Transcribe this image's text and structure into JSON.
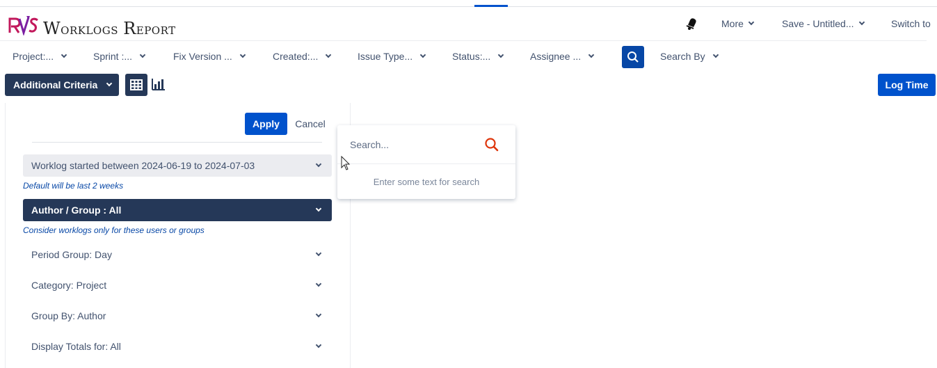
{
  "header": {
    "app_title_initial_1": "W",
    "app_title_rest_1": "orklogs",
    "app_title_initial_2": "R",
    "app_title_rest_2": "eport",
    "logo_icon": "rvs-logo",
    "notification_icon": "bell-icon",
    "more_label": "More",
    "save_label": "Save - Untitled...",
    "switch_label": "Switch to"
  },
  "filters": [
    {
      "label": "Project:..."
    },
    {
      "label": "Sprint :..."
    },
    {
      "label": "Fix Version ..."
    },
    {
      "label": "Created:..."
    },
    {
      "label": "Issue Type..."
    },
    {
      "label": "Status:..."
    },
    {
      "label": "Assignee ..."
    }
  ],
  "search_by_label": "Search By",
  "toolbar": {
    "additional_criteria_label": "Additional Criteria",
    "log_time_label": "Log Time"
  },
  "panel": {
    "apply_label": "Apply",
    "cancel_label": "Cancel",
    "criteria": [
      {
        "label": "Worklog started between 2024-06-19 to 2024-07-03",
        "hint": "Default will be last 2 weeks"
      },
      {
        "label": "Author / Group : All",
        "hint": "Consider worklogs only for these users or groups"
      },
      {
        "label": "Period Group: Day"
      },
      {
        "label": "Category: Project"
      },
      {
        "label": "Group By: Author"
      },
      {
        "label": "Display Totals for: All"
      }
    ]
  },
  "dropdown": {
    "placeholder": "Search...",
    "empty_text": "Enter some text for search"
  },
  "colors": {
    "primary": "#0052cc",
    "dark_navy": "#253858",
    "search_red": "#de350b",
    "hint_blue": "#0747a6"
  }
}
